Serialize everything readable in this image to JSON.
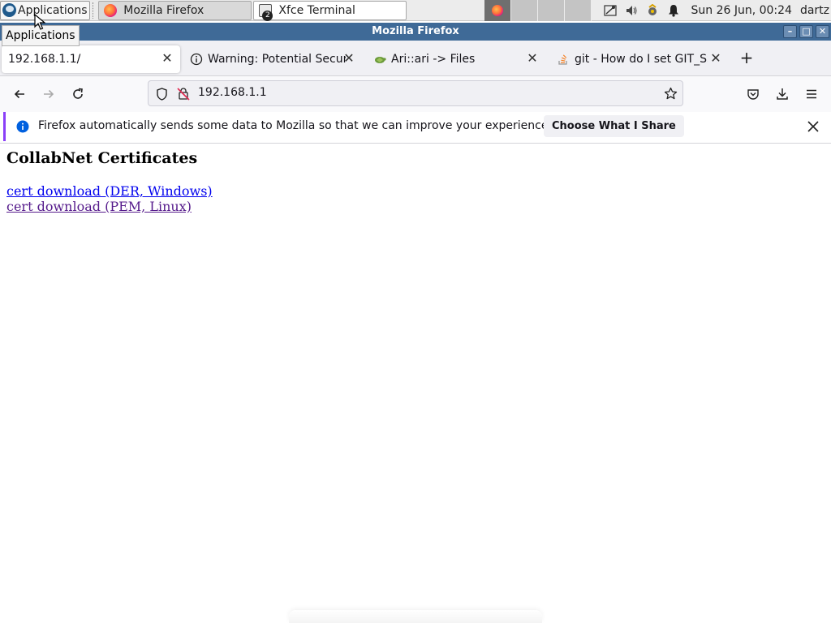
{
  "panel": {
    "app_menu_label": "Applications",
    "tasks": [
      {
        "label": "Mozilla Firefox",
        "icon": "firefox-icon"
      },
      {
        "label": "Xfce Terminal",
        "icon": "terminal-icon",
        "badge": "2"
      }
    ],
    "clock": "Sun 26 Jun, 00:24",
    "user": "dartz",
    "tray_icons": [
      "network-icon",
      "volume-icon",
      "updates-icon",
      "notification-bell-icon"
    ]
  },
  "tooltip": {
    "text": "Applications"
  },
  "window": {
    "title": "Mozilla Firefox"
  },
  "tabs": [
    {
      "title": "192.168.1.1/",
      "selected": true,
      "icon": "none"
    },
    {
      "title": "Warning: Potential Securi",
      "selected": false,
      "icon": "info-icon"
    },
    {
      "title": "Ari::ari -> Files",
      "selected": false,
      "icon": "turtle-icon"
    },
    {
      "title": "git - How do I set GIT_SSH",
      "selected": false,
      "icon": "stackoverflow-icon"
    }
  ],
  "toolbar": {
    "url": "192.168.1.1"
  },
  "notification": {
    "message": "Firefox automatically sends some data to Mozilla so that we can improve your experience.",
    "button_label": "Choose What I Share",
    "accent": "#8a3ff8",
    "info_color": "#0060df"
  },
  "page": {
    "heading": "CollabNet Certificates",
    "links": [
      {
        "text": "cert download (DER, Windows)",
        "visited": false
      },
      {
        "text": "cert download (PEM, Linux)",
        "visited": true
      }
    ],
    "link_color": "#0000ee",
    "visited_color": "#551a8b"
  }
}
